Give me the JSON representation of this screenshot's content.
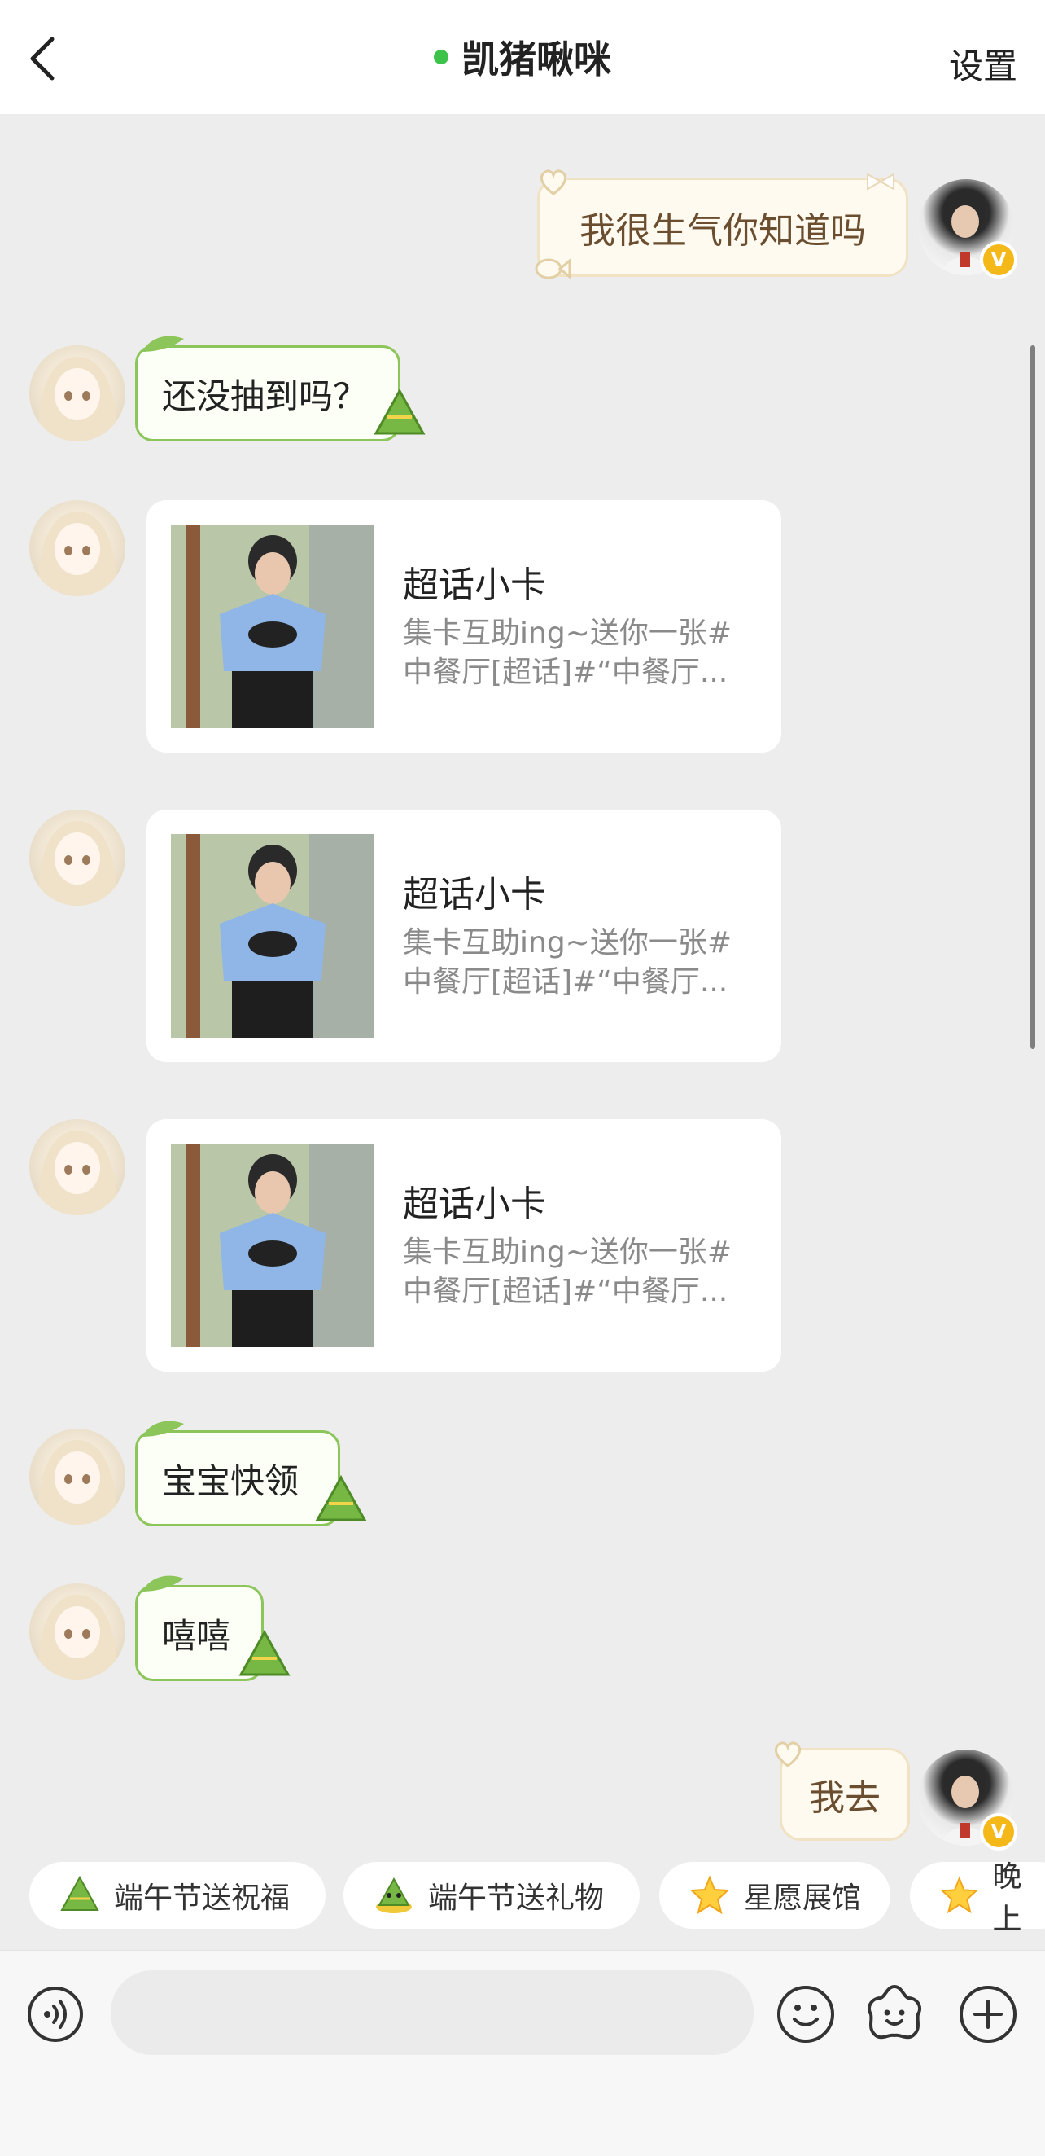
{
  "header": {
    "title": "凯猪啾咪",
    "settings_label": "设置",
    "online_color": "#3dc24a"
  },
  "messages": [
    {
      "side": "self",
      "type": "text",
      "text": "我很生气你知道吗"
    },
    {
      "side": "other",
      "type": "text",
      "text": "还没抽到吗？"
    },
    {
      "side": "other",
      "type": "card",
      "title": "超话小卡",
      "desc_line1": "集卡互助ing~送你一张#",
      "desc_line2": "中餐厅[超话]#“中餐厅..."
    },
    {
      "side": "other",
      "type": "card",
      "title": "超话小卡",
      "desc_line1": "集卡互助ing~送你一张#",
      "desc_line2": "中餐厅[超话]#“中餐厅..."
    },
    {
      "side": "other",
      "type": "card",
      "title": "超话小卡",
      "desc_line1": "集卡互助ing~送你一张#",
      "desc_line2": "中餐厅[超话]#“中餐厅..."
    },
    {
      "side": "other",
      "type": "text",
      "text": "宝宝快领"
    },
    {
      "side": "other",
      "type": "text",
      "text": "嘻嘻"
    },
    {
      "side": "self",
      "type": "text",
      "text": "我去"
    }
  ],
  "verified_badge": "V",
  "quick_actions": [
    {
      "label": "端午节送祝福",
      "icon": "zongzi-icon"
    },
    {
      "label": "端午节送礼物",
      "icon": "gift-zongzi-icon"
    },
    {
      "label": "星愿展馆",
      "icon": "star-icon"
    },
    {
      "label": "晚上",
      "icon": "star-icon"
    }
  ],
  "input": {
    "placeholder": ""
  }
}
